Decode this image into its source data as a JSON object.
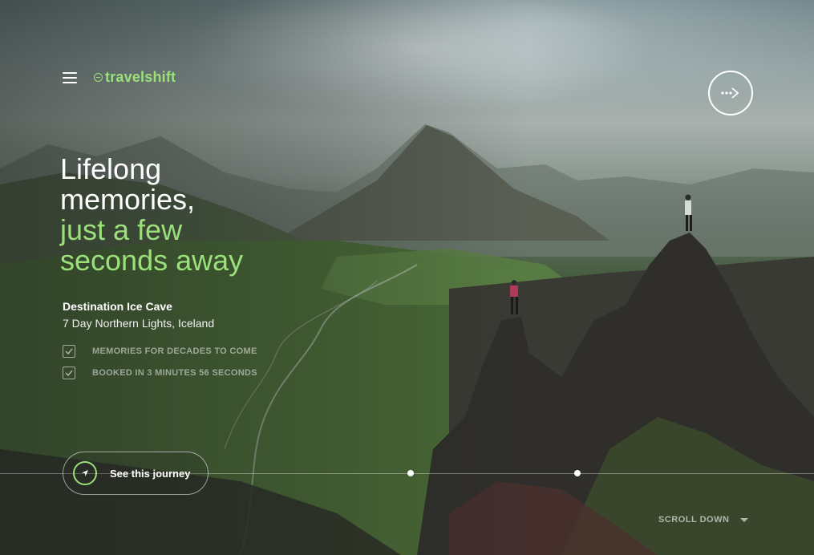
{
  "brand": {
    "logo_text": "travelshift",
    "accent_color": "#9be07a"
  },
  "nav": {
    "menu_icon": "hamburger-icon",
    "next_icon": "dotted-arrow-right-icon"
  },
  "hero": {
    "headline_lines": [
      "Lifelong",
      "memories,"
    ],
    "headline_accent_lines": [
      "just a few",
      "seconds away"
    ]
  },
  "destination": {
    "title": "Destination Ice Cave",
    "subtitle": "7 Day Northern Lights, Iceland"
  },
  "checklist": [
    {
      "label": "MEMORIES FOR DECADES TO COME",
      "checked": true
    },
    {
      "label": "BOOKED IN 3 MINUTES 56 SECONDS",
      "checked": true
    }
  ],
  "cta": {
    "label": "See this journey",
    "icon": "navigation-arrow-icon"
  },
  "scroll": {
    "label": "SCROLL DOWN",
    "icon": "caret-down-icon"
  }
}
